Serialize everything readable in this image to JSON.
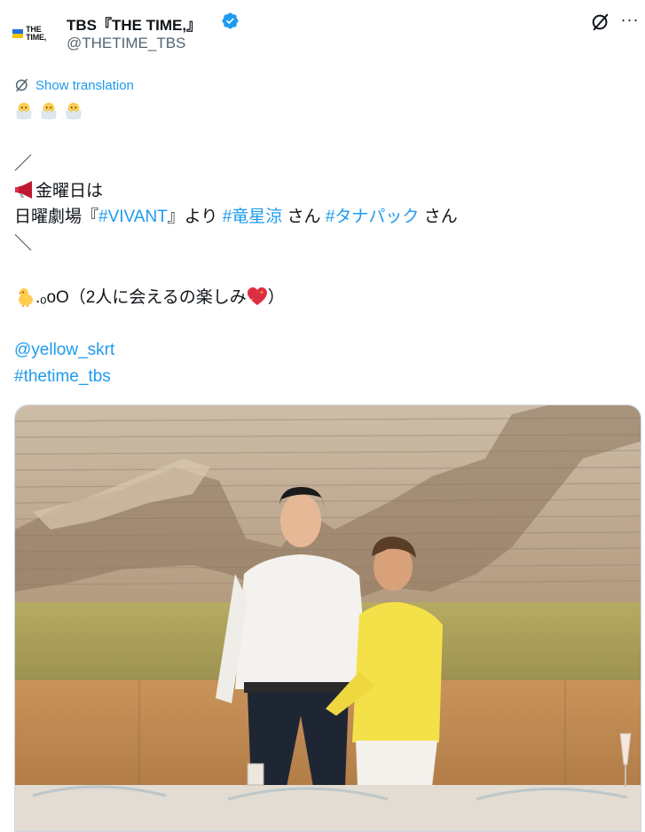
{
  "account": {
    "avatar_text": "THE TIME,",
    "display_name": "TBS『THE TIME,』",
    "handle": "@THETIME_TBS",
    "verified_icon": "verified-badge-icon"
  },
  "actions": {
    "grok_icon": "grok-icon",
    "more_label": "···"
  },
  "translation": {
    "icon": "translate-icon",
    "label": "Show translation"
  },
  "tweet": {
    "chick_emojis": [
      "hatching-chick-emoji",
      "hatching-chick-emoji",
      "hatching-chick-emoji"
    ],
    "open_slash": "／",
    "megaphone_icon": "megaphone-emoji",
    "line_friday": "金曜日は",
    "line_drama_prefix": "日曜劇場『",
    "hashtag_vivant": "#VIVANT",
    "line_drama_mid": "』より ",
    "hashtag_ryusei": "#竜星涼",
    "san1": " さん ",
    "hashtag_tanapack": "#タナパック",
    "san2": " さん",
    "close_slash": "＼",
    "chick_emoji": "baby-chick-emoji",
    "thought_text": ".ₒoO（2人に会えるの楽しみ",
    "heart_emoji": "sparkling-heart-emoji",
    "thought_close": "）",
    "mention": "@yellow_skrt",
    "hashtag_thetime": "#thetime_tbs"
  },
  "media": {
    "photo": "photo of two men in a restaurant set"
  },
  "colors": {
    "link": "#1d9bf0",
    "text": "#0f1419",
    "secondary": "#536471"
  }
}
